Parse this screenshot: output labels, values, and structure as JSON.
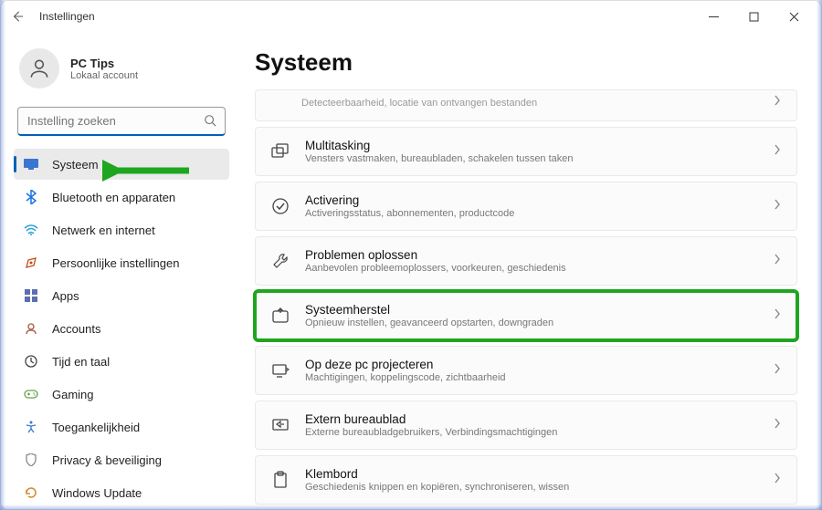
{
  "window": {
    "title": "Instellingen"
  },
  "profile": {
    "name": "PC Tips",
    "subtitle": "Lokaal account"
  },
  "search": {
    "placeholder": "Instelling zoeken"
  },
  "nav": {
    "items": [
      {
        "label": "Systeem",
        "icon": "system",
        "color": "#3a76d0",
        "active": true
      },
      {
        "label": "Bluetooth en apparaten",
        "icon": "bluetooth",
        "color": "#1a73e8"
      },
      {
        "label": "Netwerk en internet",
        "icon": "network",
        "color": "#2aa0d4"
      },
      {
        "label": "Persoonlijke instellingen",
        "icon": "personal",
        "color": "#c44a15"
      },
      {
        "label": "Apps",
        "icon": "apps",
        "color": "#5b6fb0"
      },
      {
        "label": "Accounts",
        "icon": "accounts",
        "color": "#a15c3c"
      },
      {
        "label": "Tijd en taal",
        "icon": "time",
        "color": "#444"
      },
      {
        "label": "Gaming",
        "icon": "gaming",
        "color": "#6da04a"
      },
      {
        "label": "Toegankelijkheid",
        "icon": "accessibility",
        "color": "#3a76d0"
      },
      {
        "label": "Privacy & beveiliging",
        "icon": "privacy",
        "color": "#888"
      },
      {
        "label": "Windows Update",
        "icon": "update",
        "color": "#d08a2a"
      }
    ]
  },
  "page": {
    "title": "Systeem"
  },
  "cards": [
    {
      "partial": true,
      "title": "",
      "subtitle": "Detecteerbaarheid, locatie van ontvangen bestanden",
      "icon": ""
    },
    {
      "title": "Multitasking",
      "subtitle": "Vensters vastmaken, bureaubladen, schakelen tussen taken",
      "icon": "multitask"
    },
    {
      "title": "Activering",
      "subtitle": "Activeringsstatus, abonnementen, productcode",
      "icon": "check"
    },
    {
      "title": "Problemen oplossen",
      "subtitle": "Aanbevolen probleemoplossers, voorkeuren, geschiedenis",
      "icon": "wrench"
    },
    {
      "title": "Systeemherstel",
      "subtitle": "Opnieuw instellen, geavanceerd opstarten, downgraden",
      "icon": "recovery",
      "highlighted": true
    },
    {
      "title": "Op deze pc projecteren",
      "subtitle": "Machtigingen, koppelingscode, zichtbaarheid",
      "icon": "project"
    },
    {
      "title": "Extern bureaublad",
      "subtitle": "Externe bureaubladgebruikers, Verbindingsmachtigingen",
      "icon": "remote"
    },
    {
      "title": "Klembord",
      "subtitle": "Geschiedenis knippen en kopiëren, synchroniseren, wissen",
      "icon": "clipboard"
    }
  ]
}
